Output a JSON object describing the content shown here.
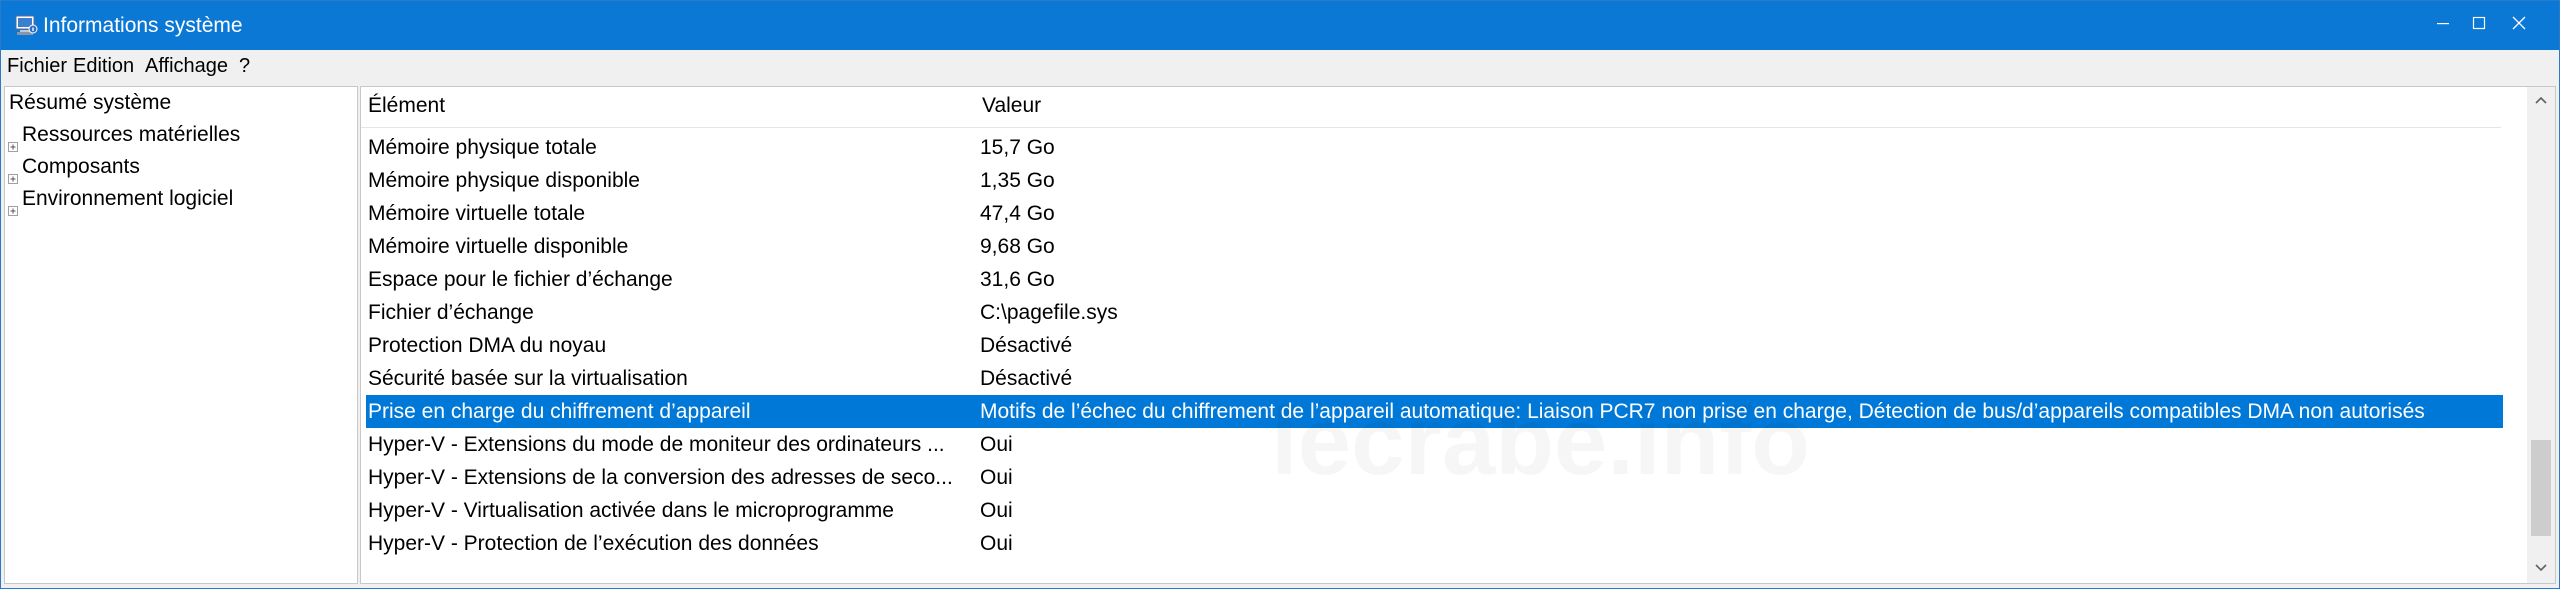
{
  "window": {
    "title": "Informations système",
    "icon": "system-info-icon",
    "controls": [
      "minimize-icon",
      "maximize-icon",
      "close-icon"
    ]
  },
  "menubar": {
    "items": [
      "Fichier",
      "Edition",
      "Affichage",
      "?"
    ]
  },
  "tree": {
    "items": [
      {
        "label": "Résumé système",
        "expandable": false
      },
      {
        "label": "Ressources matérielles",
        "expandable": true
      },
      {
        "label": "Composants",
        "expandable": true
      },
      {
        "label": "Environnement logiciel",
        "expandable": true
      }
    ]
  },
  "list": {
    "columns": [
      "Élément",
      "Valeur"
    ],
    "rows": [
      {
        "element": "Mémoire physique totale",
        "value": "15,7 Go"
      },
      {
        "element": "Mémoire physique disponible",
        "value": "1,35 Go"
      },
      {
        "element": "Mémoire virtuelle totale",
        "value": "47,4 Go"
      },
      {
        "element": "Mémoire virtuelle disponible",
        "value": "9,68 Go"
      },
      {
        "element": "Espace pour le fichier d’échange",
        "value": "31,6 Go"
      },
      {
        "element": "Fichier d’échange",
        "value": "C:\\pagefile.sys"
      },
      {
        "element": "Protection DMA du noyau",
        "value": "Désactivé"
      },
      {
        "element": "Sécurité basée sur la virtualisation",
        "value": "Désactivé"
      },
      {
        "element": "Prise en charge du chiffrement d’appareil",
        "value": "Motifs de l’échec du chiffrement de l’appareil automatique: Liaison PCR7 non prise en charge, Détection de bus/d’appareils compatibles DMA non autorisés",
        "selected": true
      },
      {
        "element": "Hyper-V - Extensions du mode de moniteur des ordinateurs ...",
        "value": "Oui"
      },
      {
        "element": "Hyper-V - Extensions de la conversion des adresses de seco...",
        "value": "Oui"
      },
      {
        "element": "Hyper-V - Virtualisation activée dans le microprogramme",
        "value": "Oui"
      },
      {
        "element": "Hyper-V - Protection de l’exécution des données",
        "value": "Oui"
      }
    ],
    "scroll_position": 0.95,
    "scroll_visible_fraction": 0.22
  },
  "watermark": "lecrabe.info",
  "colors": {
    "titlebar": "#0a78d4",
    "selection": "#0078d7"
  }
}
